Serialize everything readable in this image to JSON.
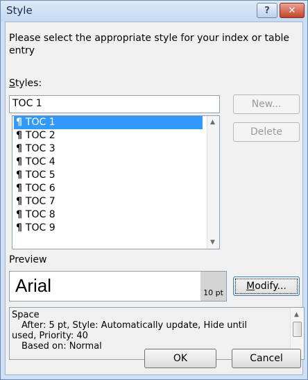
{
  "window": {
    "title": "Style",
    "help_glyph": "?",
    "close_glyph": "✕"
  },
  "instruction": "Please select the appropriate style for your index or table entry",
  "styles": {
    "label_accel": "S",
    "label_rest": "tyles:",
    "current_value": "TOC 1",
    "items": [
      {
        "mark": "¶",
        "label": "TOC 1",
        "selected": true
      },
      {
        "mark": "¶",
        "label": "TOC 2"
      },
      {
        "mark": "¶",
        "label": "TOC 3"
      },
      {
        "mark": "¶",
        "label": "TOC 4"
      },
      {
        "mark": "¶",
        "label": "TOC 5"
      },
      {
        "mark": "¶",
        "label": "TOC 6"
      },
      {
        "mark": "¶",
        "label": "TOC 7"
      },
      {
        "mark": "¶",
        "label": "TOC 8"
      },
      {
        "mark": "¶",
        "label": "TOC 9"
      }
    ]
  },
  "buttons": {
    "new": "New...",
    "delete": "Delete",
    "modify_accel": "M",
    "modify_rest": "odify...",
    "ok": "OK",
    "cancel": "Cancel"
  },
  "preview": {
    "label": "Preview",
    "font_sample": "Arial",
    "size": "10 pt"
  },
  "description": {
    "line1": "Space",
    "line2": "After: 5 pt, Style: Automatically update, Hide until",
    "line3": "used, Priority: 40",
    "line4": "Based on: Normal"
  },
  "colors": {
    "selection": "#3399ff",
    "dialog_frame": "#cfe0f4"
  }
}
